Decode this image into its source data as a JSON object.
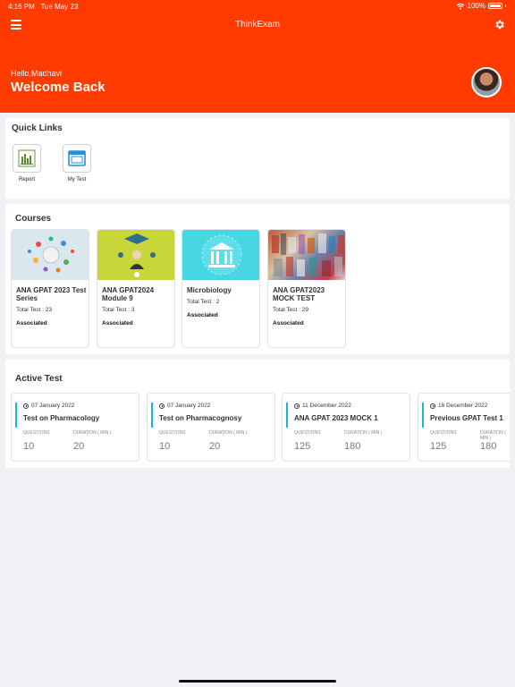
{
  "status_bar": {
    "time": "4:16 PM",
    "date": "Tue May 23",
    "battery": "100%"
  },
  "nav": {
    "title": "ThinkExam"
  },
  "header": {
    "greeting": "Hello,Madhavi",
    "welcome": "Welcome Back"
  },
  "quick_links": {
    "title": "Quick Links",
    "items": [
      {
        "label": "Report",
        "icon": "bar-chart-icon"
      },
      {
        "label": "My Test",
        "icon": "browser-window-icon"
      }
    ]
  },
  "courses": {
    "title": "Courses",
    "items": [
      {
        "name": "ANA GPAT 2023 Test Series",
        "total": "Total Test : 23",
        "status": "Associated"
      },
      {
        "name": "ANA GPAT2024 Module 9",
        "total": "Total Test : 3",
        "status": "Associated"
      },
      {
        "name": "Microbiology",
        "total": "Total Test : 2",
        "status": "Associated"
      },
      {
        "name": "ANA GPAT2023 MOCK TEST",
        "total": "Total Test : 29",
        "status": "Associated"
      }
    ]
  },
  "active_test": {
    "title": "Active Test",
    "questions_label": "QUESTIONS",
    "duration_label": "DURATION ( MIN )",
    "items": [
      {
        "date": "07 January 2022",
        "name": "Test on Pharmacology",
        "questions": "10",
        "duration": "20"
      },
      {
        "date": "07 January 2022",
        "name": "Test on Pharmacognosy",
        "questions": "10",
        "duration": "20"
      },
      {
        "date": "11 December 2022",
        "name": "ANA GPAT 2023 MOCK 1",
        "questions": "125",
        "duration": "180"
      },
      {
        "date": "18 December 2022",
        "name": "Previous GPAT Test 1",
        "questions": "125",
        "duration": "180"
      }
    ]
  },
  "colors": {
    "brand": "#ff3b00",
    "accent": "#19b6d8"
  }
}
